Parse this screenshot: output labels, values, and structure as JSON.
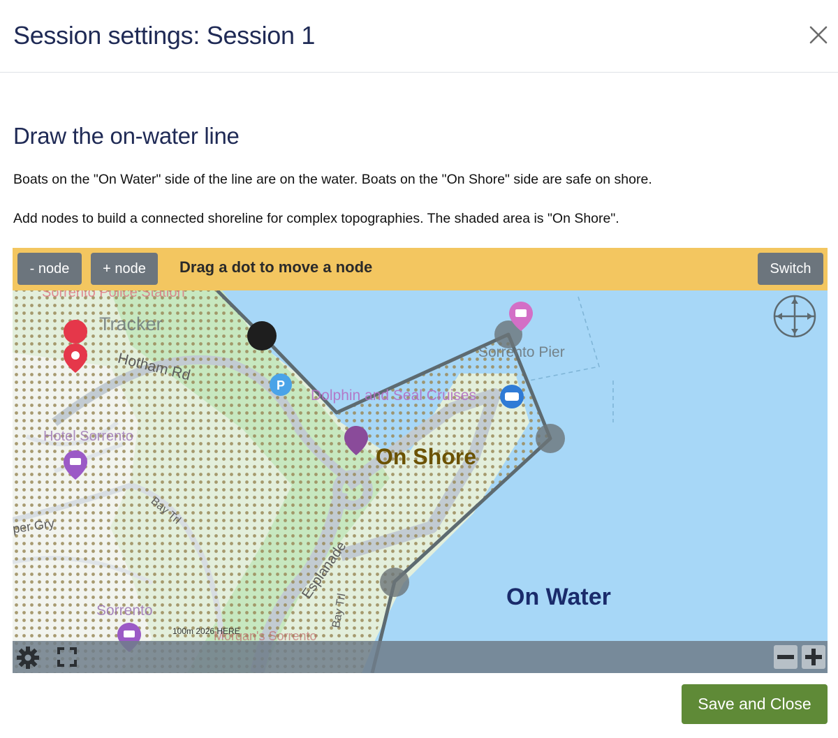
{
  "modal": {
    "title": "Session settings: Session 1"
  },
  "section": {
    "title": "Draw the on-water line",
    "paragraph_1": "Boats on the \"On Water\" side of the line are on the water. Boats on the \"On Shore\" side are safe on shore.",
    "paragraph_2": "Add nodes to build a connected shoreline for complex topographies. The shaded area is \"On Shore\"."
  },
  "toolbar": {
    "remove_node_label": "- node",
    "add_node_label": "+ node",
    "hint": "Drag a dot to move a node",
    "switch_label": "Switch"
  },
  "map": {
    "labels": {
      "on_shore": "On Shore",
      "on_water": "On Water",
      "police": "Sorrento Police Station",
      "tracker": "Tracker",
      "road_hotham": "Hotham Rd",
      "dolphin": "Dolphin and Seal Cruises",
      "pier": "Sorrento Pier",
      "hotel": "Hotel Sorrento",
      "per_gry": "per Gry",
      "bay_trl": "Bay Trl",
      "esplanade": "Esplanade",
      "sorrento": "Sorrento",
      "morgans": "Morgan's Sorrento",
      "scale": "100m  2026 HERE"
    },
    "colors": {
      "water": "#a7d7f7",
      "land": "#e3efdc",
      "green": "#c7e8c0",
      "shore_dots": "#9a8a5a",
      "line": "#5d6a70",
      "active_node": "#1e1e1e"
    }
  },
  "actions": {
    "save_label": "Save and Close"
  }
}
